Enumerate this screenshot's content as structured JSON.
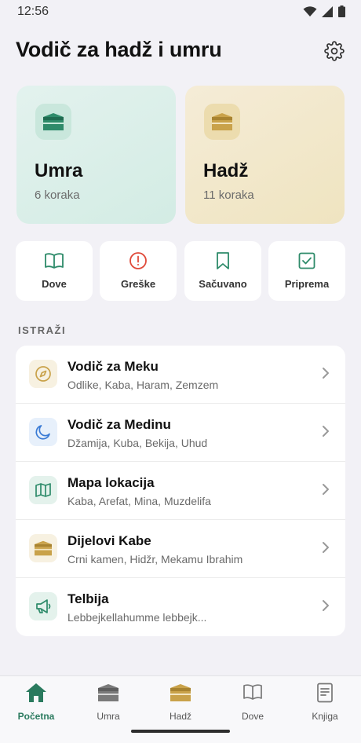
{
  "status_bar": {
    "time": "12:56"
  },
  "header": {
    "title": "Vodič za hadž i umru"
  },
  "cards": [
    {
      "title": "Umra",
      "subtitle": "6 koraka",
      "icon": "kaaba-icon",
      "color": "#2e8b6a"
    },
    {
      "title": "Hadž",
      "subtitle": "11 koraka",
      "icon": "kaaba-icon",
      "color": "#c9a24a"
    }
  ],
  "quick_actions": [
    {
      "label": "Dove",
      "icon": "book-icon",
      "color": "#2e8b6a"
    },
    {
      "label": "Greške",
      "icon": "alert-icon",
      "color": "#e04a3a"
    },
    {
      "label": "Sačuvano",
      "icon": "bookmark-icon",
      "color": "#2e8b6a"
    },
    {
      "label": "Priprema",
      "icon": "checkbox-icon",
      "color": "#2e8b6a"
    }
  ],
  "section": {
    "label": "ISTRAŽI"
  },
  "explore": [
    {
      "title": "Vodič za Meku",
      "subtitle": "Odlike, Kaba, Haram, Zemzem",
      "icon": "compass-icon"
    },
    {
      "title": "Vodič za Medinu",
      "subtitle": "Džamija, Kuba, Bekija, Uhud",
      "icon": "moon-icon"
    },
    {
      "title": "Mapa lokacija",
      "subtitle": "Kaba, Arefat, Mina, Muzdelifa",
      "icon": "map-icon"
    },
    {
      "title": "Dijelovi Kabe",
      "subtitle": "Crni kamen, Hidžr, Mekamu Ibrahim",
      "icon": "kaaba-icon"
    },
    {
      "title": "Telbija",
      "subtitle": "Lebbejkellahumme lebbejk...",
      "icon": "megaphone-icon"
    }
  ],
  "nav": [
    {
      "label": "Početna",
      "icon": "home-icon",
      "active": true
    },
    {
      "label": "Umra",
      "icon": "kaaba-icon",
      "active": false
    },
    {
      "label": "Hadž",
      "icon": "kaaba-icon",
      "active": false
    },
    {
      "label": "Dove",
      "icon": "book-icon",
      "active": false
    },
    {
      "label": "Knjiga",
      "icon": "document-icon",
      "active": false
    }
  ],
  "colors": {
    "accent": "#2e8b6a",
    "gold": "#c9a24a",
    "error": "#e04a3a",
    "background": "#f2f1f6"
  }
}
